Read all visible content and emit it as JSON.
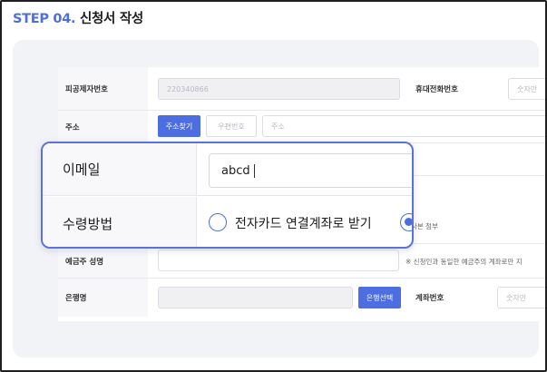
{
  "header": {
    "step": "STEP 04.",
    "title": "신청서 작성"
  },
  "form": {
    "insured_number": {
      "label": "피공제자번호",
      "value": "220340866"
    },
    "mobile": {
      "label": "휴대전화번호",
      "placeholder": "숫자만"
    },
    "address": {
      "label": "주소",
      "search_button": "주소찾기",
      "postcode_placeholder": "우편번호",
      "address_placeholder": "주소"
    },
    "attachment_note": "사본 첨부",
    "account_holder": {
      "label": "예금주 성명",
      "note": "※ 신청인과 동일한 예금주의 계좌로만 지"
    },
    "bank": {
      "label": "은행명",
      "select_button": "은행선택"
    },
    "account_number": {
      "label": "계좌번호",
      "placeholder": "숫자만"
    }
  },
  "popup": {
    "email": {
      "label": "이메일",
      "value": "abcd"
    },
    "receive_method": {
      "label": "수령방법",
      "options": [
        {
          "label": "전자카드 연결계좌로 받기",
          "selected": false
        },
        {
          "label": "",
          "selected": true
        }
      ]
    }
  }
}
